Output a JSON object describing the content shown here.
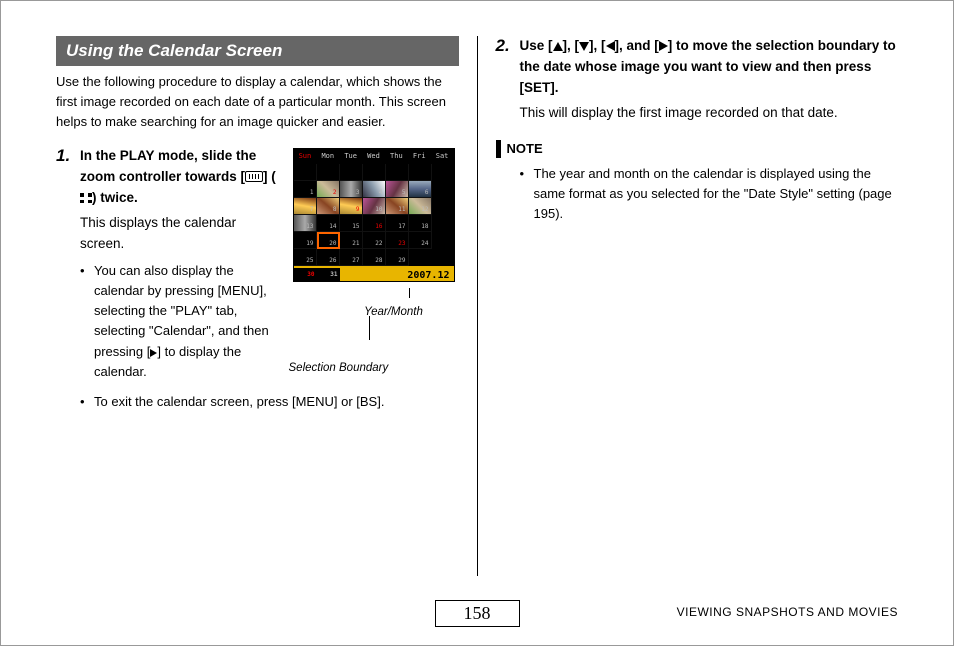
{
  "section_title": "Using the Calendar Screen",
  "intro": "Use the following procedure to display a calendar, which shows the first image recorded on each date of a particular month. This screen helps to make searching for an image quicker and easier.",
  "step1": {
    "num": "1.",
    "title_a": "In the PLAY mode, slide the zoom controller towards [",
    "title_b": "] (",
    "title_c": ") twice.",
    "desc": "This displays the calendar screen.",
    "bullet1a": "You can also display the calendar by pressing [MENU], selecting the \"PLAY\" tab, selecting \"Calendar\", and then pressing [",
    "bullet1b": "] to display the calendar.",
    "bullet2": "To exit the calendar screen, press [MENU] or [BS]."
  },
  "figure": {
    "year_month_label": "Year/Month",
    "selection_boundary_label": "Selection Boundary",
    "days": [
      "Sun",
      "Mon",
      "Tue",
      "Wed",
      "Thu",
      "Fri",
      "Sat"
    ],
    "footer_date": "2007.12"
  },
  "step2": {
    "num": "2.",
    "title_a": "Use [",
    "title_b": "], [",
    "title_c": "], [",
    "title_d": "], and [",
    "title_e": "] to move the selection boundary to the date whose image you want to view and then press [SET].",
    "desc": "This will display the first image recorded on that date."
  },
  "note": {
    "heading": "NOTE",
    "bullet": "The year and month on the calendar is displayed using the same format as you selected for the \"Date Style\" setting (page 195)."
  },
  "page_number": "158",
  "footer_label": "VIEWING SNAPSHOTS AND MOVIES"
}
